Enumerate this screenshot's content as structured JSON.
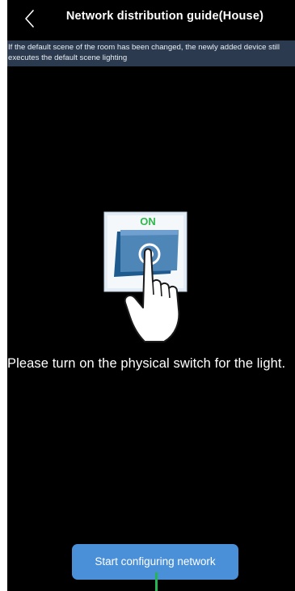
{
  "header": {
    "title": "Network distribution guide(House)",
    "back_icon": "chevron-left-icon"
  },
  "notice": {
    "text": "If the default scene of the room has been changed, the newly added device still executes the default scene lighting"
  },
  "illustration": {
    "switch_label": "ON"
  },
  "instruction": {
    "text": "Please turn on the physical switch for the light."
  },
  "actions": {
    "start_label": "Start configuring network"
  },
  "colors": {
    "background": "#000000",
    "notice_bg": "#2b3a4e",
    "button": "#4a90d9",
    "switch_on_text": "#2eb84b"
  }
}
